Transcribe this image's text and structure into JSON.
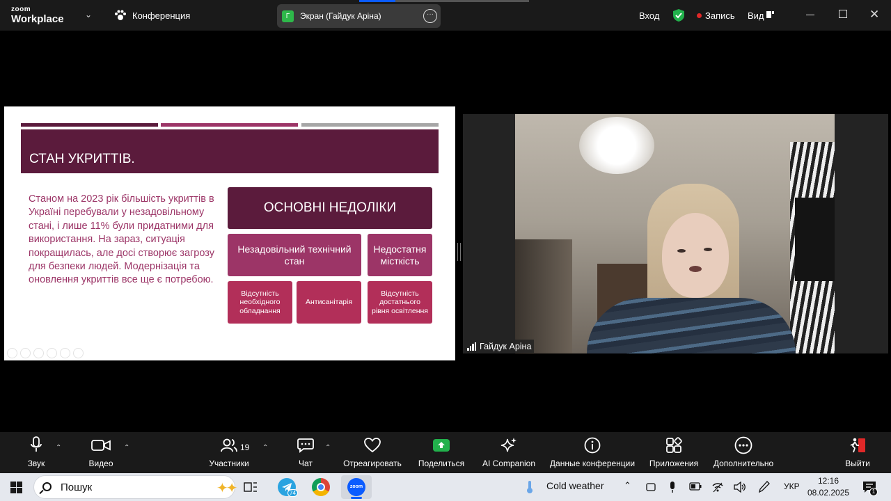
{
  "app": {
    "logo_line1": "zoom",
    "logo_line2": "Workplace",
    "conference_label": "Конференция"
  },
  "share_pill": {
    "avatar_letter": "Г",
    "label": "Экран (Гайдук Аріна)",
    "more": "···"
  },
  "top_right": {
    "login": "Вход",
    "record": "Запись",
    "view": "Вид"
  },
  "slide": {
    "title": "СТАН УКРИТТІВ.",
    "body": "Станом на 2023 рік більшість укриттів в Україні перебували у незадовільному стані, і лише 11% були придатними для використання. На зараз, ситуація покращилась, але досі створює загрозу для безпеки людей. Модернізація та оновлення укриттів все ще є потребою.",
    "main_box": "ОСНОВНІ НЕДОЛІКИ",
    "box_tech": "Незадовільний технічний стан",
    "box_capacity": "Недостатня місткість",
    "sub_equipment": "Відсутність необхідного обладнання",
    "sub_sanitary": "Антисанітарія",
    "sub_lighting": "Відсутність достатнього рівня освітлення",
    "colors": {
      "dark": "#5b1b3c",
      "mid": "#9c3567",
      "light": "#b22f59",
      "grey": "#a6a6a6"
    }
  },
  "participant": {
    "name": "Гайдук Аріна"
  },
  "toolbar": {
    "audio": "Звук",
    "video": "Видео",
    "participants": "Участники",
    "participants_count": "19",
    "chat": "Чат",
    "react": "Отреагировать",
    "share": "Поделиться",
    "ai": "AI Companion",
    "info": "Данные конференции",
    "apps": "Приложения",
    "more": "Дополнительно",
    "leave": "Выйти"
  },
  "taskbar": {
    "search_placeholder": "Пошук",
    "weather": "Cold weather",
    "telegram_badge": "74",
    "language": "УКР",
    "time": "12:16",
    "date": "08.02.2025",
    "notif_count": "1"
  }
}
